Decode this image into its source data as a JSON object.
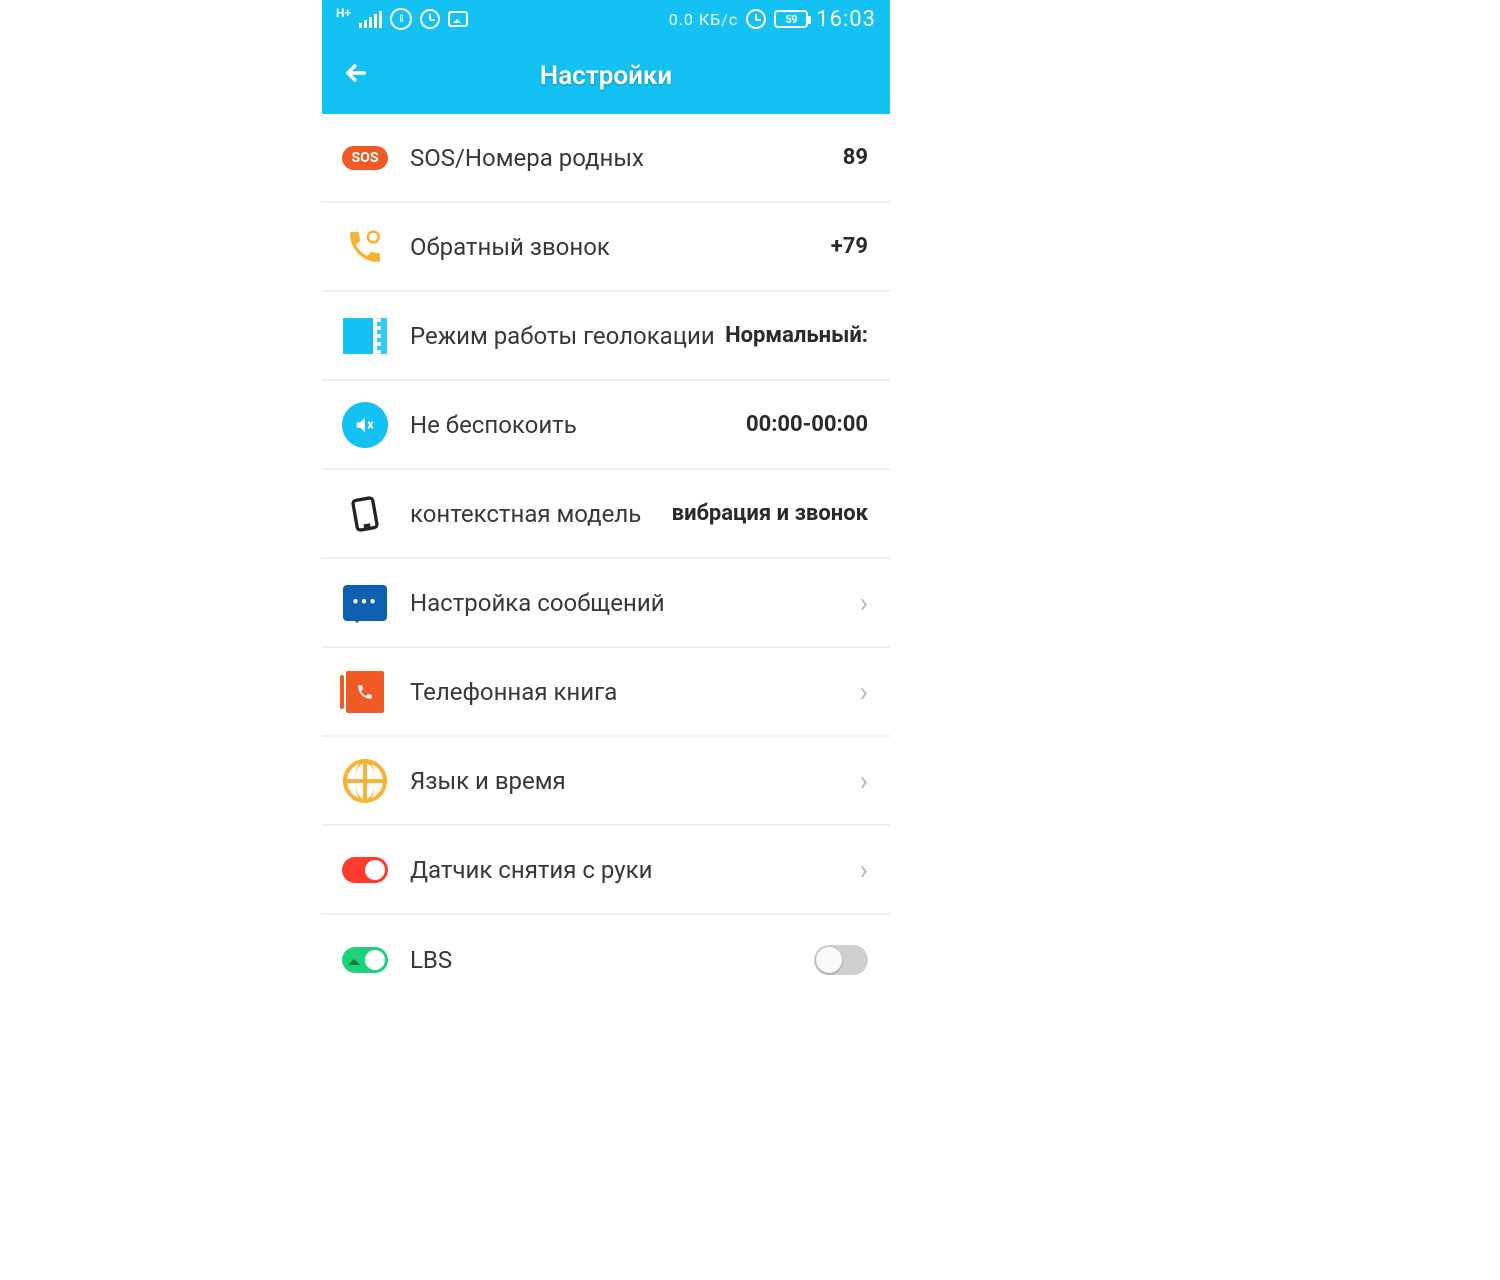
{
  "status": {
    "network_type": "H+",
    "data_speed": "0.0 КБ/с",
    "battery_percent": "59",
    "time": "16:03"
  },
  "header": {
    "title": "Настройки"
  },
  "rows": {
    "sos": {
      "label": "SOS/Номера родных",
      "value": "89"
    },
    "callback": {
      "label": "Обратный звонок",
      "value": "+79"
    },
    "geo": {
      "label": "Режим работы геолокации",
      "value": "Нормальный:"
    },
    "dnd": {
      "label": "Не беспокоить",
      "value": "00:00-00:00"
    },
    "profile": {
      "label": "контекстная модель",
      "value": "вибрация и звонок"
    },
    "messages": {
      "label": "Настройка сообщений"
    },
    "phonebook": {
      "label": "Телефонная книга"
    },
    "lang": {
      "label": "Язык и время"
    },
    "takeoff": {
      "label": "Датчик снятия с руки"
    },
    "lbs": {
      "label": "LBS"
    }
  }
}
